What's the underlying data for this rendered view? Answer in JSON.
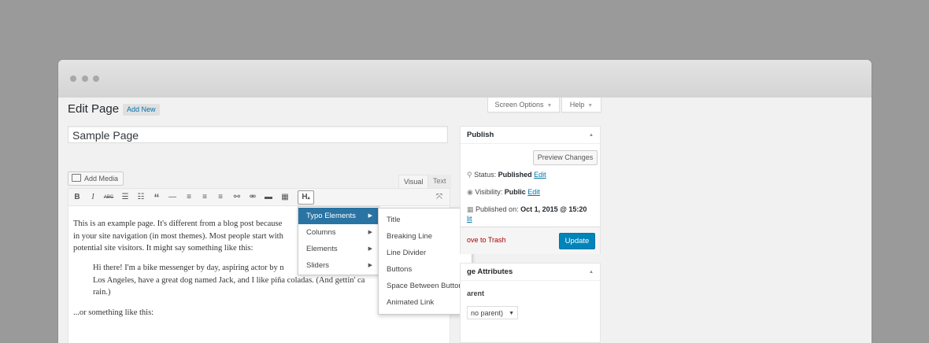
{
  "screen_options": {
    "screen_options_label": "Screen Options",
    "help_label": "Help",
    "arrow": "▼"
  },
  "header": {
    "title": "Edit Page",
    "add_new": "Add New"
  },
  "post": {
    "title": "Sample Page"
  },
  "editor": {
    "add_media": "Add Media",
    "tab_visual": "Visual",
    "tab_text": "Text",
    "toolbar_icons": [
      "bold-icon",
      "italic-icon",
      "strikethrough-icon",
      "bullet-list-icon",
      "numbered-list-icon",
      "blockquote-icon",
      "horizontal-line-icon",
      "align-left-icon",
      "align-center-icon",
      "align-right-icon",
      "insert-link-icon",
      "remove-link-icon",
      "read-more-icon",
      "toolbar-toggle-icon",
      "heading-dropdown-icon",
      "fullscreen-icon"
    ],
    "heading_button": "H",
    "para1": [
      "This is an example page. It's different from a blog post because",
      "in your site navigation (in most themes). Most people start with",
      "potential site visitors. It might say something like this:"
    ],
    "quote": [
      "Hi there! I'm a bike messenger by day, aspiring actor by n",
      "Los Angeles, have a great dog named Jack, and I like piña coladas. (And gettin' ca",
      "rain.)"
    ],
    "para2": "...or something like this:"
  },
  "dropdown_menu": {
    "items": [
      {
        "label": "Typo Elements",
        "active": true
      },
      {
        "label": "Columns",
        "active": false
      },
      {
        "label": "Elements",
        "active": false
      },
      {
        "label": "Sliders",
        "active": false
      }
    ],
    "submenu": [
      "Title",
      "Breaking Line",
      "Line Divider",
      "Buttons",
      "Space Between Buttons",
      "Animated Link"
    ]
  },
  "publish": {
    "heading": "Publish",
    "preview": "Preview Changes",
    "status_label": "Status:",
    "status_value": "Published",
    "visibility_label": "Visibility:",
    "visibility_value": "Public",
    "edit": "Edit",
    "published_on_label": "Published on:",
    "published_on_value": "Oct 1, 2015 @ 15:20",
    "edit_partial": "lit",
    "trash": "ove to Trash",
    "update": "Update"
  },
  "page_attributes": {
    "heading": "ge Attributes",
    "parent_label": "arent",
    "parent_value": "no parent)"
  },
  "colors": {
    "accent": "#0073aa",
    "menu_active": "#2a74a4",
    "update_button": "#0085ba",
    "trash": "#aa0000"
  }
}
